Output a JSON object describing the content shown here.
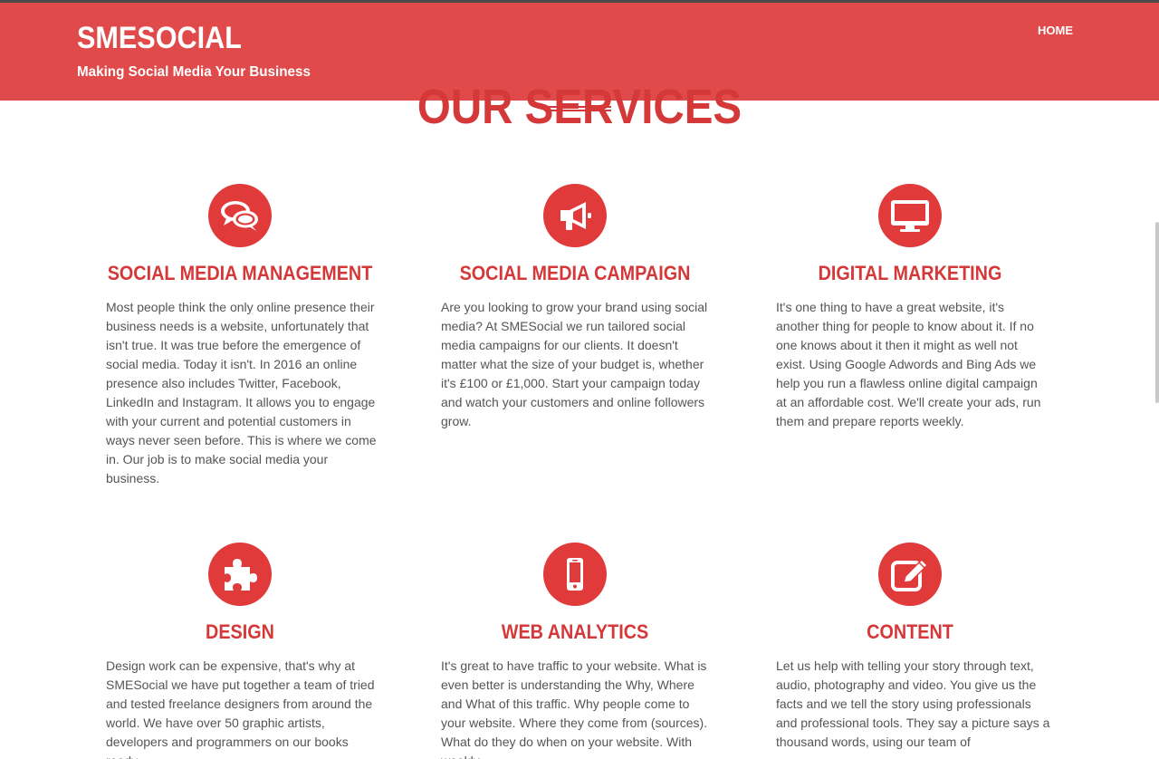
{
  "header": {
    "brand": "SMESOCIAL",
    "tagline": "Making Social Media Your Business",
    "nav_home": "HOME"
  },
  "section": {
    "heading": "OUR SERVICES"
  },
  "colors": {
    "header_bg": "#e04a4a",
    "accent": "#d53838",
    "icon_bg": "#e03a3a",
    "body_text": "#555555"
  },
  "services": [
    {
      "icon": "chat-bubbles-icon",
      "title": "SOCIAL MEDIA MANAGEMENT",
      "description": "Most people think the only online presence their business needs is a website, unfortunately that isn't true. It was true before the emergence of social media. Today it isn't. In 2016 an online presence also includes Twitter, Facebook, LinkedIn and Instagram. It allows you to engage with your current and potential customers in ways never seen before. This is where we come in. Our job is to make social media your business."
    },
    {
      "icon": "megaphone-icon",
      "title": "SOCIAL MEDIA CAMPAIGN",
      "description": "Are you looking to grow your brand using social media? At SMESocial we run tailored social media campaigns for our clients. It doesn't matter what the size of your budget is, whether it's £100 or £1,000. Start your campaign today and watch your customers and online followers grow."
    },
    {
      "icon": "desktop-monitor-icon",
      "title": "DIGITAL MARKETING",
      "description": "It's one thing to have a great website, it's another thing for people to know about it.  If no one knows about it then it might as well not exist. Using Google Adwords and Bing Ads we help you run a flawless online digital campaign at an affordable cost. We'll create your ads, run them and prepare reports weekly."
    },
    {
      "icon": "puzzle-piece-icon",
      "title": "DESIGN",
      "description": "Design work can be expensive, that's why at SMESocial we have put together a team of tried and tested freelance designers from around the world. We have over 50 graphic artists, developers and programmers on our books ready"
    },
    {
      "icon": "mobile-phone-icon",
      "title": "WEB ANALYTICS",
      "description": "It's great to have traffic to your website. What is even better is understanding the Why, Where and What of this traffic. Why people come to your website. Where they come from (sources). What do they do when on your website. With weekly"
    },
    {
      "icon": "edit-pencil-icon",
      "title": "CONTENT",
      "description": "Let us help with telling your story through text, audio, photography and video. You give us the facts and we tell the story using professionals and professional tools. They say a picture says a thousand words, using our team of"
    }
  ]
}
